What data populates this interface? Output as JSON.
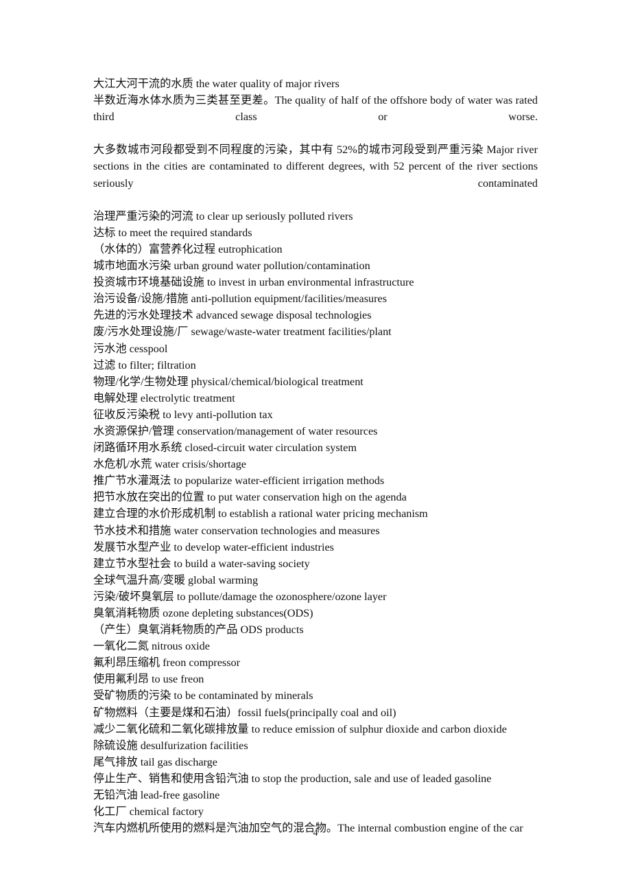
{
  "document": {
    "page_number": "4",
    "lines": [
      {
        "id": "line-1",
        "type": "entry",
        "text": "大江大河干流的水质 the water quality of major rivers"
      },
      {
        "id": "line-2",
        "type": "paragraph",
        "text": "半数近海水体水质为三类甚至更差。The quality of half of the offshore body of water was rated third class or worse."
      },
      {
        "id": "line-3",
        "type": "paragraph",
        "text": "大多数城市河段都受到不同程度的污染，其中有 52%的城市河段受到严重污染 Major river sections in the cities are contaminated to different degrees, with 52 percent of the river sections seriously contaminated"
      },
      {
        "id": "line-4",
        "type": "entry",
        "text": "治理严重污染的河流 to clear up seriously polluted rivers"
      },
      {
        "id": "line-5",
        "type": "entry",
        "text": "达标 to meet the required standards"
      },
      {
        "id": "line-6",
        "type": "entry",
        "text": "（水体的）富营养化过程 eutrophication"
      },
      {
        "id": "line-7",
        "type": "entry",
        "text": "城市地面水污染 urban ground water pollution/contamination"
      },
      {
        "id": "line-8",
        "type": "entry",
        "text": "投资城市环境基础设施 to invest in urban environmental infrastructure"
      },
      {
        "id": "line-9",
        "type": "entry",
        "text": "治污设备/设施/措施 anti-pollution equipment/facilities/measures"
      },
      {
        "id": "line-10",
        "type": "entry",
        "text": "先进的污水处理技术 advanced sewage disposal technologies"
      },
      {
        "id": "line-11",
        "type": "entry",
        "text": "废/污水处理设施/厂 sewage/waste-water treatment facilities/plant"
      },
      {
        "id": "line-12",
        "type": "entry",
        "text": "污水池 cesspool"
      },
      {
        "id": "line-13",
        "type": "entry",
        "text": "过滤 to filter; filtration"
      },
      {
        "id": "line-14",
        "type": "entry",
        "text": "物理/化学/生物处理 physical/chemical/biological treatment"
      },
      {
        "id": "line-15",
        "type": "entry",
        "text": "电解处理 electrolytic treatment"
      },
      {
        "id": "line-16",
        "type": "entry",
        "text": "征收反污染税 to levy anti-pollution tax"
      },
      {
        "id": "line-17",
        "type": "entry",
        "text": "水资源保护/管理 conservation/management of water resources"
      },
      {
        "id": "line-18",
        "type": "entry",
        "text": "闭路循环用水系统 closed-circuit water circulation system"
      },
      {
        "id": "line-19",
        "type": "entry",
        "text": "水危机/水荒 water crisis/shortage"
      },
      {
        "id": "line-20",
        "type": "entry",
        "text": "推广节水灌溉法 to popularize water-efficient irrigation methods"
      },
      {
        "id": "line-21",
        "type": "entry",
        "text": "把节水放在突出的位置 to put water conservation high on the agenda"
      },
      {
        "id": "line-22",
        "type": "entry",
        "text": "建立合理的水价形成机制 to establish a rational water pricing mechanism"
      },
      {
        "id": "line-23",
        "type": "entry",
        "text": "节水技术和措施 water conservation technologies and measures"
      },
      {
        "id": "line-24",
        "type": "entry",
        "text": "发展节水型产业 to develop water-efficient industries"
      },
      {
        "id": "line-25",
        "type": "entry",
        "text": "建立节水型社会 to build a water-saving society"
      },
      {
        "id": "line-26",
        "type": "entry",
        "text": "全球气温升高/变暖 global warming"
      },
      {
        "id": "line-27",
        "type": "entry",
        "text": "污染/破坏臭氧层 to pollute/damage the ozonosphere/ozone layer"
      },
      {
        "id": "line-28",
        "type": "entry",
        "text": "臭氧消耗物质 ozone depleting substances(ODS)"
      },
      {
        "id": "line-29",
        "type": "entry",
        "text": "（产生）臭氧消耗物质的产品 ODS products"
      },
      {
        "id": "line-30",
        "type": "entry",
        "text": "一氧化二氮 nitrous oxide"
      },
      {
        "id": "line-31",
        "type": "entry",
        "text": "氟利昂压缩机 freon compressor"
      },
      {
        "id": "line-32",
        "type": "entry",
        "text": "使用氟利昂 to use freon"
      },
      {
        "id": "line-33",
        "type": "entry",
        "text": "受矿物质的污染 to be contaminated by minerals"
      },
      {
        "id": "line-34",
        "type": "entry",
        "text": "矿物燃料（主要是煤和石油）fossil fuels(principally coal and oil)"
      },
      {
        "id": "line-35",
        "type": "entry",
        "text": "减少二氧化硫和二氧化碳排放量 to reduce emission of sulphur dioxide and carbon dioxide"
      },
      {
        "id": "line-36",
        "type": "entry",
        "text": "除硫设施 desulfurization facilities"
      },
      {
        "id": "line-37",
        "type": "entry",
        "text": "尾气排放 tail gas discharge"
      },
      {
        "id": "line-38",
        "type": "entry",
        "text": "停止生产、销售和使用含铅汽油 to stop the production, sale and use of leaded gasoline"
      },
      {
        "id": "line-39",
        "type": "entry",
        "text": "无铅汽油 lead-free gasoline"
      },
      {
        "id": "line-40",
        "type": "entry",
        "text": "化工厂 chemical factory"
      },
      {
        "id": "line-41",
        "type": "entry",
        "text": "汽车内燃机所使用的燃料是汽油加空气的混合物。The internal combustion engine of the car"
      }
    ]
  }
}
